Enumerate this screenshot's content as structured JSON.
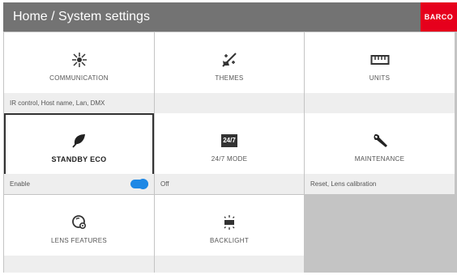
{
  "header": {
    "title": "Home / System settings",
    "logo": "BARCO"
  },
  "tiles": [
    {
      "icon": "communication-icon",
      "label": "COMMUNICATION",
      "status": "IR control, Host name, Lan, DMX"
    },
    {
      "icon": "themes-icon",
      "label": "THEMES",
      "status": ""
    },
    {
      "icon": "units-icon",
      "label": "UNITS",
      "status": ""
    },
    {
      "icon": "leaf-icon",
      "label": "STANDBY ECO",
      "status": "Enable",
      "toggle": true
    },
    {
      "icon": "24-7-icon",
      "icon_text": "24/7",
      "label": "24/7 MODE",
      "status": "Off"
    },
    {
      "icon": "wrench-icon",
      "label": "MAINTENANCE",
      "status": "Reset, Lens calibration"
    },
    {
      "icon": "lens-features-icon",
      "label": "LENS FEATURES",
      "status": ""
    },
    {
      "icon": "backlight-icon",
      "label": "BACKLIGHT",
      "status": ""
    }
  ],
  "colors": {
    "header_bg": "#737373",
    "logo_bg": "#e6001c",
    "toggle": "#1e88e5",
    "tile_bg": "#ffffff",
    "status_bg": "#eeeeee"
  }
}
